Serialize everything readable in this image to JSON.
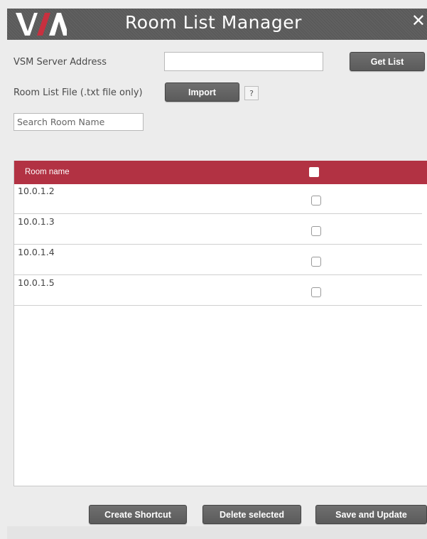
{
  "window": {
    "title": "Room List Manager",
    "close_glyph": "✕",
    "logo_text": "VIA",
    "colors": {
      "titlebar": "#5f5f5f",
      "table_header": "#b23243",
      "button": "#626262"
    }
  },
  "form": {
    "server_label": "VSM Server Address",
    "server_value": "",
    "get_list_label": "Get List",
    "file_label": "Room List File (.txt file only)",
    "import_label": "Import",
    "help_label": "?",
    "search_placeholder": "Search Room Name",
    "search_value": ""
  },
  "table": {
    "header_room": "Room name",
    "rows": [
      {
        "name": "10.0.1.2",
        "checked": false
      },
      {
        "name": "10.0.1.3",
        "checked": false
      },
      {
        "name": "10.0.1.4",
        "checked": false
      },
      {
        "name": "10.0.1.5",
        "checked": false
      }
    ]
  },
  "footer": {
    "create_shortcut": "Create Shortcut",
    "delete_selected": "Delete selected",
    "save_update": "Save and Update"
  }
}
